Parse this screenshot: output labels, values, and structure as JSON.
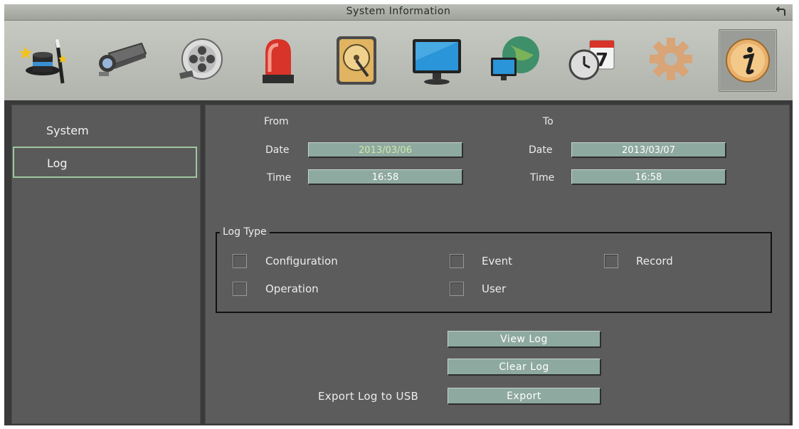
{
  "window": {
    "title": "System Information"
  },
  "toolbar": {
    "icons": [
      "wizard-icon",
      "camera-icon",
      "record-reel-icon",
      "alarm-light-icon",
      "hard-disk-icon",
      "monitor-icon",
      "network-globe-icon",
      "schedule-clock-icon",
      "settings-gear-icon",
      "info-icon"
    ],
    "active_icon": "info-icon"
  },
  "sidebar": {
    "items": [
      {
        "label": "System",
        "selected": false
      },
      {
        "label": "Log",
        "selected": true
      }
    ]
  },
  "range": {
    "from_label": "From",
    "to_label": "To",
    "date_label": "Date",
    "time_label": "Time",
    "from_date": "2013/03/06",
    "from_time": "16:58",
    "to_date": "2013/03/07",
    "to_time": "16:58"
  },
  "log_type": {
    "legend": "Log  Type",
    "options": [
      {
        "label": "Configuration",
        "checked": false
      },
      {
        "label": "Event",
        "checked": false
      },
      {
        "label": "Record",
        "checked": false
      },
      {
        "label": "Operation",
        "checked": false
      },
      {
        "label": "User",
        "checked": false
      }
    ]
  },
  "actions": {
    "view_log": "View  Log",
    "clear_log": "Clear  Log",
    "export_label": "Export  Log  to  USB",
    "export": "Export"
  },
  "colors": {
    "field_bg": "#8ea9a0",
    "selection_border": "#9fc79f",
    "from_date_text": "#cfe9a8"
  }
}
